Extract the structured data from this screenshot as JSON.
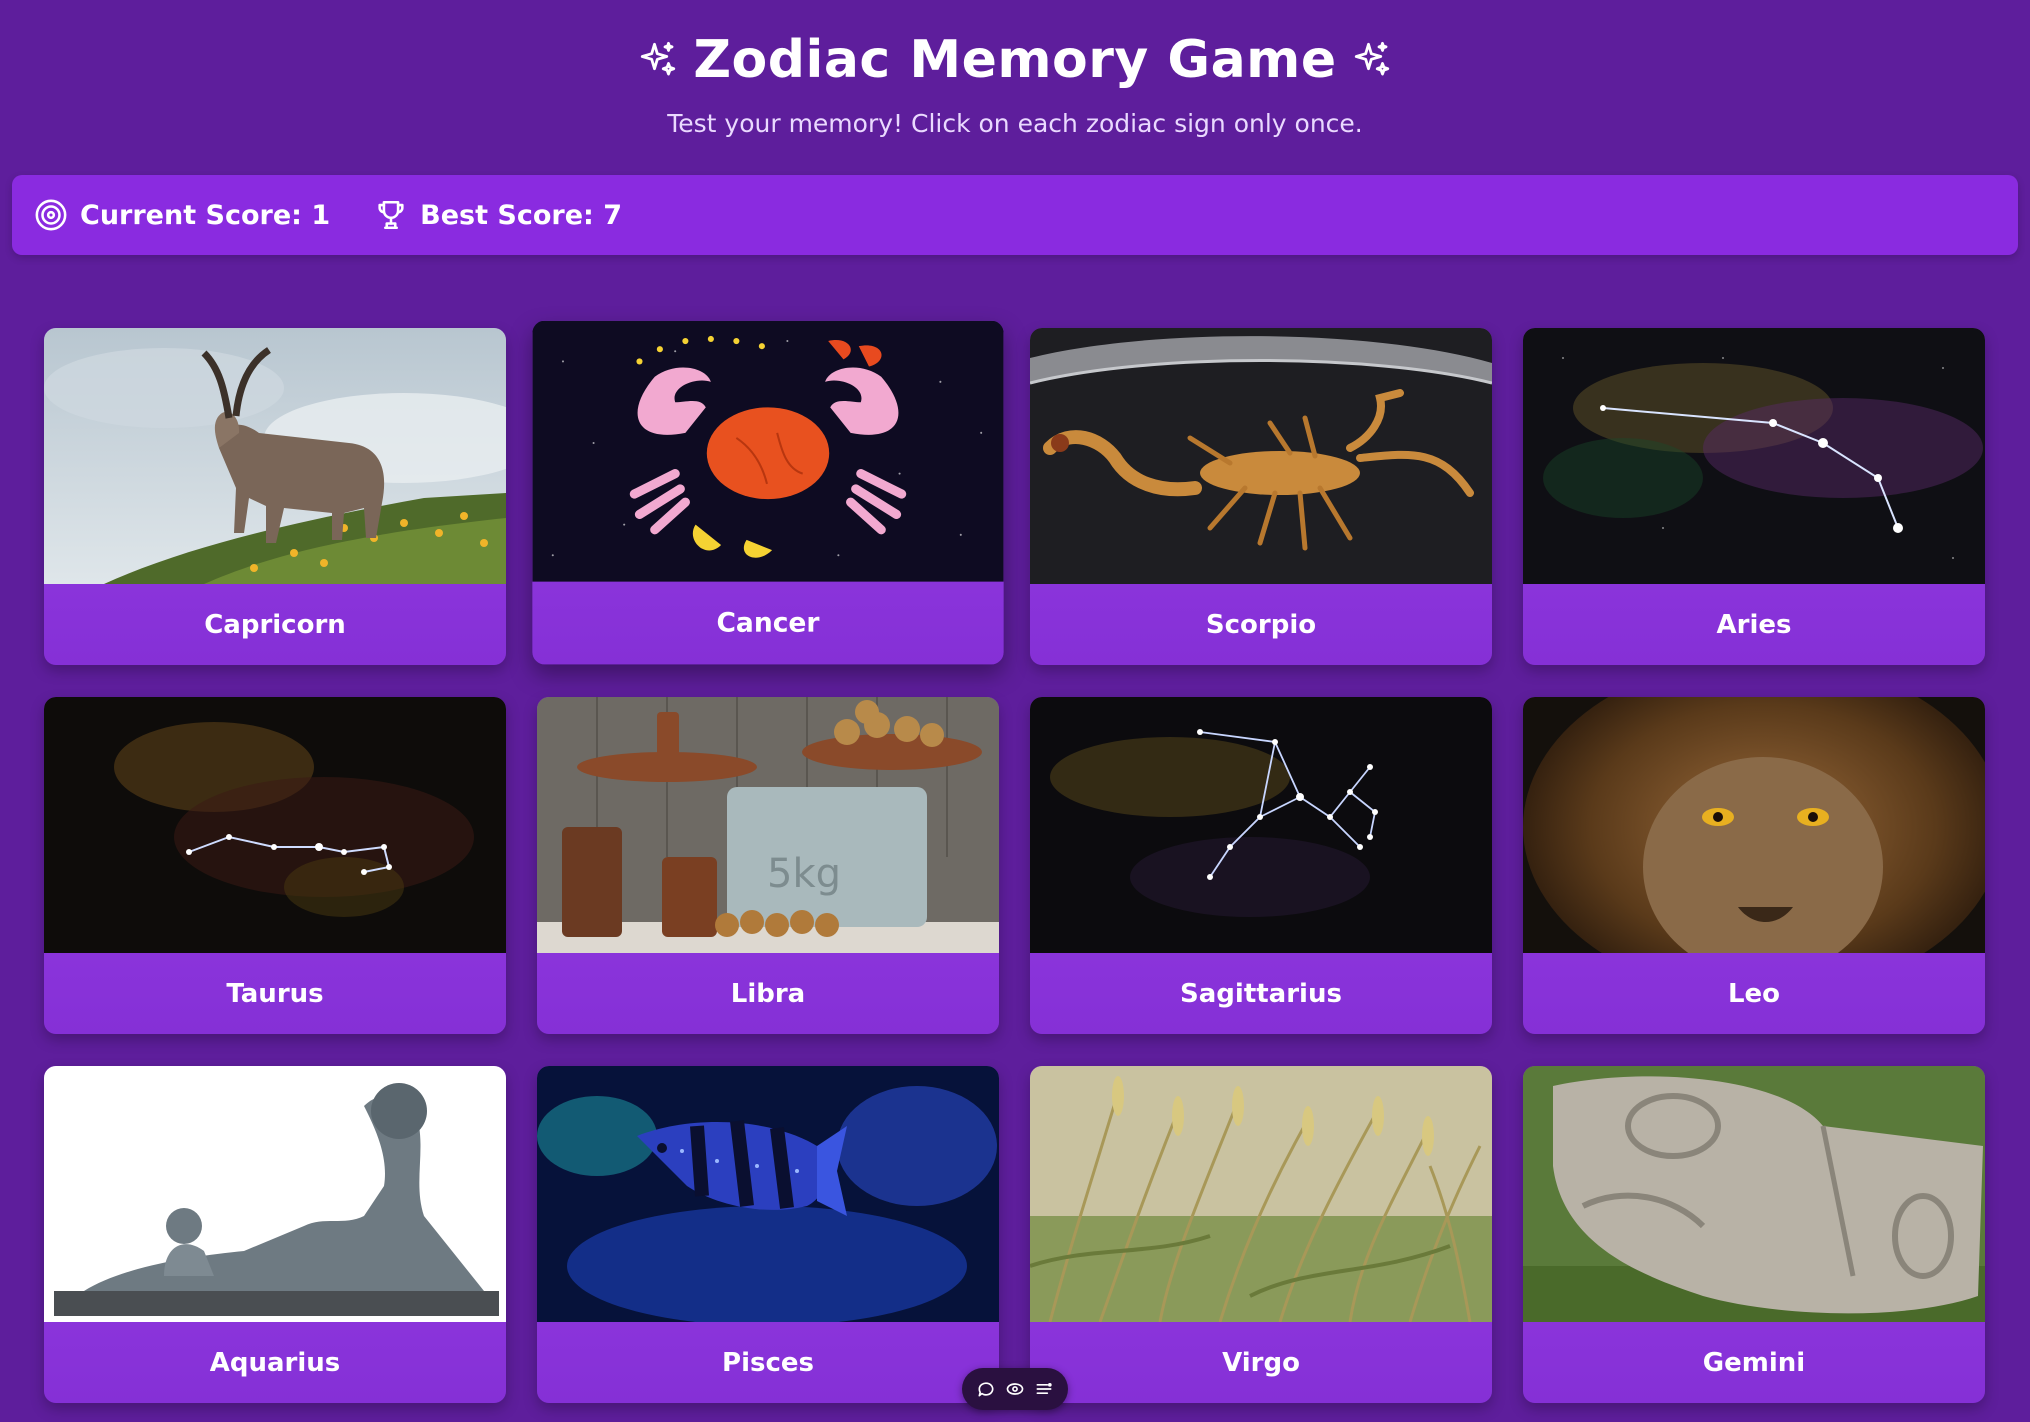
{
  "header": {
    "title": "Zodiac Memory Game",
    "subtitle": "Test your memory! Click on each zodiac sign only once."
  },
  "scores": {
    "current_label": "Current Score: 1",
    "best_label": "Best Score: 7",
    "current_icon": "target-icon",
    "best_icon": "trophy-icon"
  },
  "cards": [
    {
      "label": "Capricorn",
      "image": "ibex-on-hillside"
    },
    {
      "label": "Cancer",
      "image": "crab-illustration"
    },
    {
      "label": "Scorpio",
      "image": "scorpion-photo"
    },
    {
      "label": "Aries",
      "image": "aries-constellation"
    },
    {
      "label": "Taurus",
      "image": "taurus-constellation"
    },
    {
      "label": "Libra",
      "image": "vintage-scales"
    },
    {
      "label": "Sagittarius",
      "image": "sagittarius-constellation"
    },
    {
      "label": "Leo",
      "image": "lion-face"
    },
    {
      "label": "Aquarius",
      "image": "river-god-statue"
    },
    {
      "label": "Pisces",
      "image": "fish-aquarium"
    },
    {
      "label": "Virgo",
      "image": "wheat-field"
    },
    {
      "label": "Gemini",
      "image": "stone-faces-sculpture"
    }
  ],
  "toolbar": {
    "icons": [
      "chat-icon",
      "eye-icon",
      "menu-icon"
    ]
  },
  "colors": {
    "background": "#5e1e9c",
    "score_bar": "#8a2be0",
    "card_label": "#9b40ea"
  }
}
